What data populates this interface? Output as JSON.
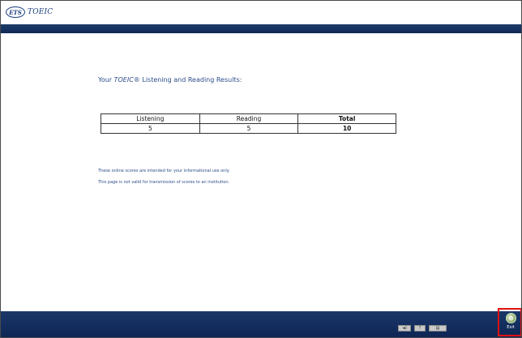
{
  "header": {
    "logo_badge": "ETS",
    "logo_text": "TOEIC"
  },
  "results": {
    "title_prefix": "Your ",
    "title_brand": "TOEIC®",
    "title_suffix": " Listening and Reading Results:"
  },
  "scores_table": {
    "headers": [
      "Listening",
      "Reading",
      "Total"
    ],
    "values": [
      "5",
      "5",
      "10"
    ]
  },
  "notes": [
    "These online scores are intended for your informational use only.",
    "This page is not valid for transmission of scores to an institution."
  ],
  "footer": {
    "exit_label": "Exit"
  },
  "icons": {
    "exit": "exit-icon",
    "controls": [
      "volume-icon",
      "help-icon",
      "settings-icon"
    ]
  },
  "colors": {
    "band": "#12305f",
    "text_accent": "#2e4d8a",
    "exit_highlight": "#e01010"
  }
}
